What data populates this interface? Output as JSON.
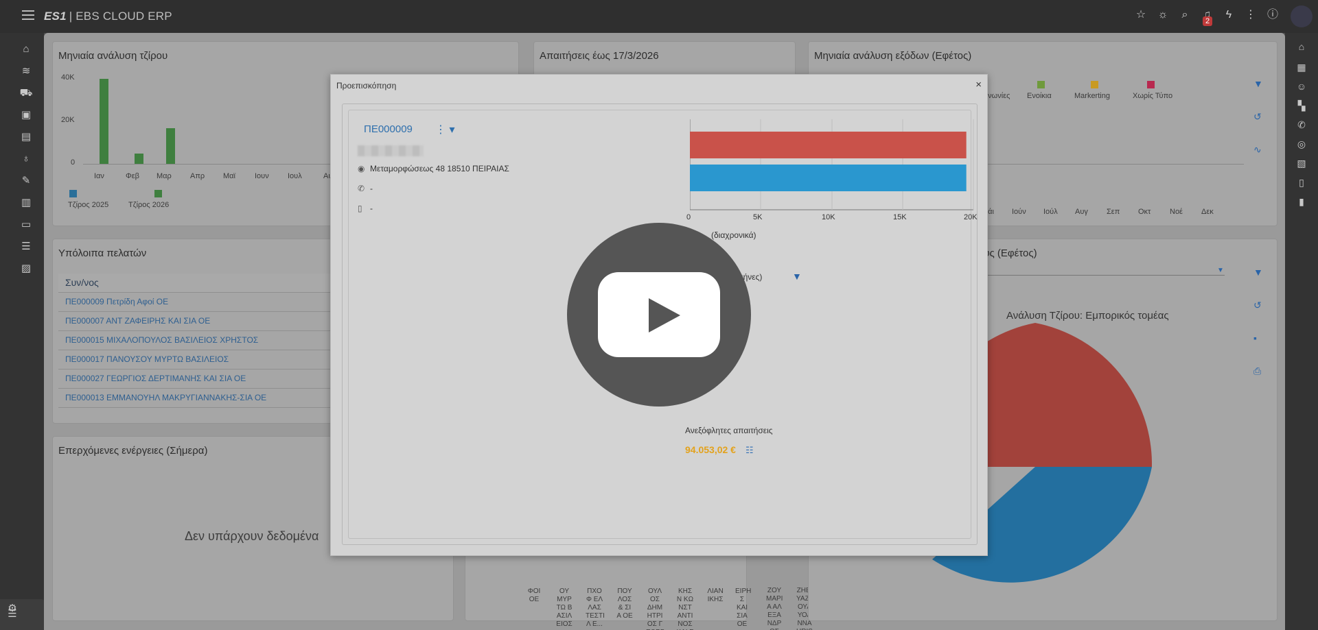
{
  "app": {
    "logo": "ES1",
    "title": "| EBS CLOUD ERP",
    "notification_count": "2"
  },
  "top_icons": [
    "star-icon",
    "lightbulb-icon",
    "search-icon",
    "bell-icon",
    "bolt-icon",
    "more-vert-icon",
    "info-icon"
  ],
  "background": {
    "turnover_panel": {
      "title": "Μηνιαία ανάλυση τζίρου",
      "y_ticks": [
        "40K",
        "20K",
        "0"
      ],
      "months": [
        "Ιαν",
        "Φεβ",
        "Μαρ",
        "Απρ",
        "Μαϊ",
        "Ιουν",
        "Ιουλ",
        "Αυ"
      ],
      "legend": [
        "Τζίρος 2025",
        "Τζίρος 2026"
      ],
      "colors": {
        "2025": "#2f8bc4",
        "2026": "#3f8a3f"
      }
    },
    "receivables_panel": {
      "title": "Απαιτήσεις έως 17/3/2026"
    },
    "expenses_panel": {
      "title": "Μηνιαία ανάλυση εξόδων (Εφέτος)",
      "legend": [
        "...νωνίες",
        "Ενοίκια",
        "Markerting",
        "Χωρίς Τύπο"
      ],
      "months": [
        "Μάι",
        "Ιούν",
        "Ιούλ",
        "Αυγ",
        "Σεπ",
        "Οκτ",
        "Νοέ",
        "Δεκ"
      ]
    },
    "balances_panel": {
      "title": "Υπόλοιπα πελατών",
      "column": "Συν/νος",
      "rows": [
        "ΠΕ000009 Πετρίδη Αφοί ΟΕ",
        "ΠΕ000007 ΑΝΤ ΖΑΦΕΙΡΗΣ ΚΑΙ ΣΙΑ ΟΕ",
        "ΠΕ000015 ΜΙΧΑΛΟΠΟΥΛΟΣ ΒΑΣΙΛΕΙΟΣ ΧΡΗΣΤΟΣ",
        "ΠΕ000017 ΠΑΝΟΥΣΟΥ ΜΥΡΤΩ ΒΑΣΙΛΕΙΟΣ",
        "ΠΕ000027 ΓΕΩΡΓΙΟΣ ΔΕΡΤΙΜΑΝΗΣ ΚΑΙ ΣΙΑ ΟΕ",
        "ΠΕ000013 ΕΜΜΑΝΟΥΗΛ ΜΑΚΡΥΓΙΑΝΝΑΚΗΣ-ΣΙΑ ΟΕ"
      ]
    },
    "actions_panel": {
      "title": "Επερχόμενες ενέργειες (Σήμερα)",
      "empty": "Δεν υπάρχουν δεδομένα"
    },
    "cost_panel": {
      "title_fragment": "στους (Εφέτος)",
      "pie_title": "Ανάλυση Τζίρου: Εμπορικός τομέας",
      "colors": [
        "#b04a42",
        "#2a7ab0"
      ]
    },
    "vertical_labels": [
      "ΦΟΙ ΟΕ",
      "ΟΥ ΜΥΡ ΤΩ Β ΑΣΙΛ ΕΙΟΣ",
      "ΠΧΟ Φ ΕΛ ΛΑΣ ΤΕΣΤΙ Λ Ε...",
      "ΠΟΥ ΛΟΣ & ΣΙ Α ΟΕ",
      "ΟΥΛ ΟΣ ΔΗΜ ΗΤΡΙ ΟΣ Γ ΕΩΡΓ ΙΟΣ",
      "ΚΗΣ Ν ΚΩ ΝΣΤ ΑΝΤΙ ΝΟΣ ΚΑΙ Σ ΙΑ ...",
      "ΛΙΑΝ ΙΚΗΣ",
      "ΕΙΡΗ Σ ΚΑΙ ΣΙΑ ΟΕ",
      "ΖΟΥ ΜΑΡΙ Α ΑΛ ΕΞΑ ΝΔΡ ΟΣ",
      "ΖΗΕΙ ΥΑΖΚ ΟΥΑ ΥΟΑ ΝΝΑ HRIS ΤΟ"
    ]
  },
  "modal": {
    "title": "Προεπισκόπηση",
    "close": "×",
    "customer_code": "ΠΕ000009",
    "address": "Μεταμορφώσεως 48 18510 ΠΕΙΡΑΙΑΣ",
    "phone": "-",
    "mobile": "-",
    "bar_chart": {
      "x_ticks": [
        "0",
        "5K",
        "10K",
        "15K",
        "20K"
      ],
      "bars": [
        {
          "value": 19500,
          "color": "#c9524a"
        },
        {
          "value": 19500,
          "color": "#2a97cf"
        }
      ],
      "xlim": [
        0,
        20000
      ]
    },
    "subtitle_partial": "(διαχρονικά)",
    "period_partial": "οι μήνες)",
    "unpaid_label": "Ανεξόφλητες απαιτήσεις",
    "unpaid_value": "94.053,02 €"
  }
}
